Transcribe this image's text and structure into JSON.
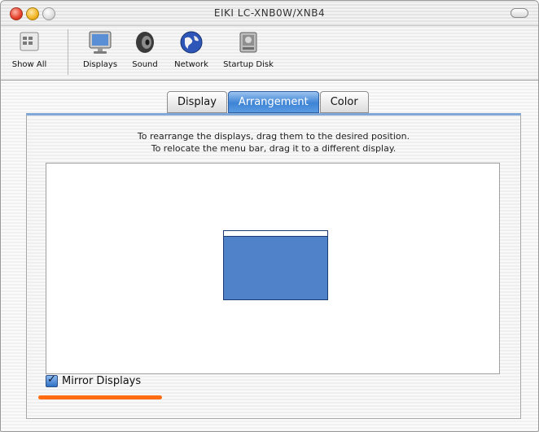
{
  "window": {
    "title": "EIKI LC-XNB0W/XNB4"
  },
  "toolbar": {
    "items": [
      {
        "label": "Show All",
        "icon": "apple-prefs-icon"
      },
      {
        "label": "Displays",
        "icon": "monitor-icon"
      },
      {
        "label": "Sound",
        "icon": "speaker-icon"
      },
      {
        "label": "Network",
        "icon": "globe-icon"
      },
      {
        "label": "Startup Disk",
        "icon": "hard-disk-icon"
      }
    ]
  },
  "tabs": [
    {
      "label": "Display",
      "selected": false
    },
    {
      "label": "Arrangement",
      "selected": true
    },
    {
      "label": "Color",
      "selected": false
    }
  ],
  "arrangement": {
    "instruction_line1": "To rearrange the displays, drag them to the desired position.",
    "instruction_line2": "To relocate the menu bar, drag it to a different display."
  },
  "mirror": {
    "label": "Mirror Displays",
    "checked": true
  },
  "colors": {
    "accent": "#3e84d6",
    "display": "#4f82c9",
    "highlight": "#ff6c12"
  }
}
